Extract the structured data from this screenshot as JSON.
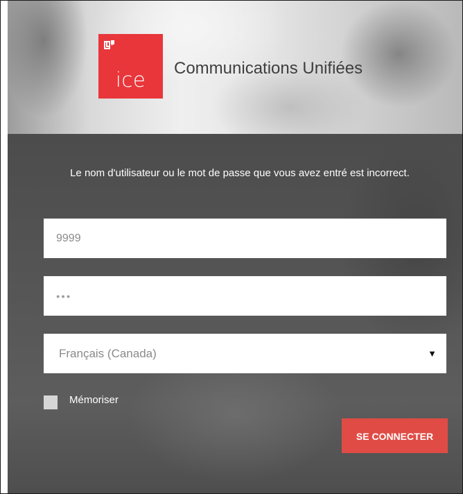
{
  "brand": {
    "logo_text": "ice",
    "logo_icon": "lync-icon",
    "app_title": "Communications Unifiées",
    "accent_color": "#e8363b"
  },
  "login": {
    "error_message": "Le nom d'utilisateur ou le mot de passe que vous avez entré est incorrect.",
    "username_value": "9999",
    "password_value": "●●●",
    "language_selected": "Français (Canada)",
    "remember_label": "Mémoriser",
    "remember_checked": false,
    "submit_label": "SE CONNECTER",
    "button_color": "#e04c45"
  }
}
